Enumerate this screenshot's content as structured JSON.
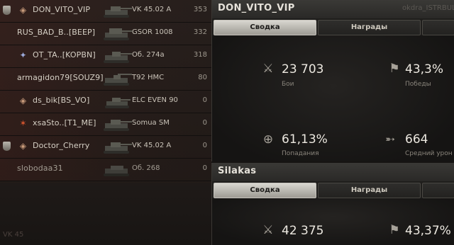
{
  "roster": [
    {
      "name": "DON_VITO_VIP",
      "tank": "VK 45.02 A",
      "score": "353",
      "badge": true,
      "rank_icon": "diamond-rank-icon"
    },
    {
      "name": "RUS_BAD_B..[BEEP]",
      "tank": "GSOR 1008",
      "score": "332",
      "badge": false,
      "rank_icon": ""
    },
    {
      "name": "OT_TA..[KOPBN]",
      "tank": "Об. 274a",
      "score": "318",
      "badge": false,
      "rank_icon": "clan-emblem-icon"
    },
    {
      "name": "armagidon79[SOUZ9]",
      "tank": "T92 HMC",
      "score": "80",
      "badge": false,
      "rank_icon": ""
    },
    {
      "name": "ds_bik[BS_VO]",
      "tank": "ELC EVEN 90",
      "score": "0",
      "badge": false,
      "rank_icon": "diamond-rank-icon"
    },
    {
      "name": "xsaSto..[T1_ME]",
      "tank": "Somua SM",
      "score": "0",
      "badge": false,
      "rank_icon": "clan-emblem-icon"
    },
    {
      "name": "Doctor_Cherry",
      "tank": "VK 45.02 A",
      "score": "0",
      "badge": true,
      "rank_icon": "diamond-rank-icon"
    },
    {
      "name": "slobodaa31",
      "tank": "Об. 268",
      "score": "0",
      "badge": false,
      "rank_icon": ""
    }
  ],
  "panel1": {
    "title": "DON_VITO_VIP",
    "ghost_name": "okdra_ISTRBUL",
    "tab_summary": "Сводка",
    "tab_awards": "Награды",
    "battles_value": "23 703",
    "battles_label": "Бои",
    "wins_value": "43,3%",
    "wins_label": "Победы",
    "hits_value": "61,13%",
    "hits_label": "Попадания",
    "damage_value": "664",
    "damage_label": "Средний урон"
  },
  "panel2": {
    "title": "Silakas",
    "tab_summary": "Сводка",
    "tab_awards": "Награды",
    "battles_value": "42 375",
    "wins_value": "43,37%"
  },
  "footer_ghost": "VK 45"
}
